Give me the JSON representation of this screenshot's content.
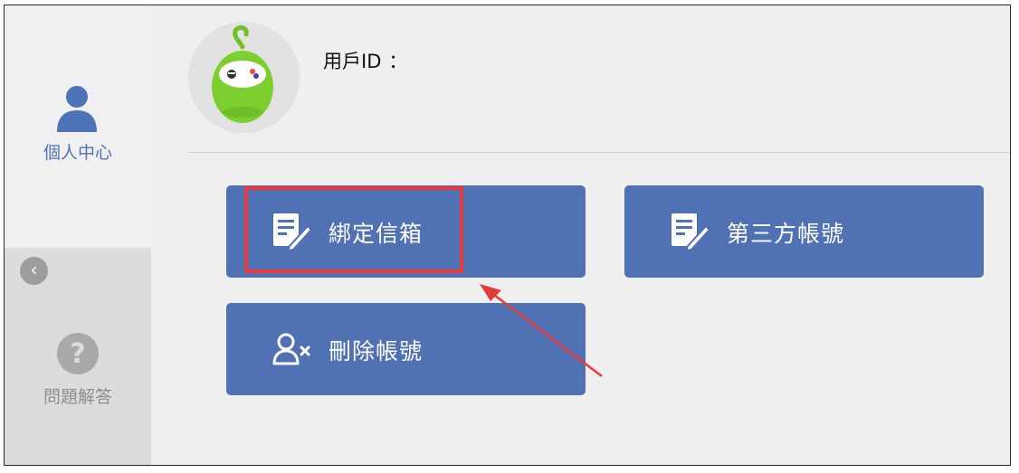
{
  "sidebar": {
    "items": [
      {
        "label": "個人中心",
        "icon": "person-icon",
        "active": true
      },
      {
        "label": "問題解答",
        "icon": "question-icon",
        "active": false
      }
    ],
    "back_icon": "chevron-left-icon"
  },
  "header": {
    "user_id_label": "用戶ID",
    "user_id_separator": "：",
    "user_id_value": "",
    "avatar": "green-mascot-avatar"
  },
  "actions": [
    {
      "label": "綁定信箱",
      "icon": "edit-document-icon"
    },
    {
      "label": "第三方帳號",
      "icon": "edit-document-icon"
    },
    {
      "label": "刪除帳號",
      "icon": "remove-user-icon"
    }
  ],
  "colors": {
    "accent": "#5171b5",
    "sidebar_active_text": "#4f73b8",
    "highlight": "#e53a3a",
    "mascot_green": "#7ccf2f"
  }
}
